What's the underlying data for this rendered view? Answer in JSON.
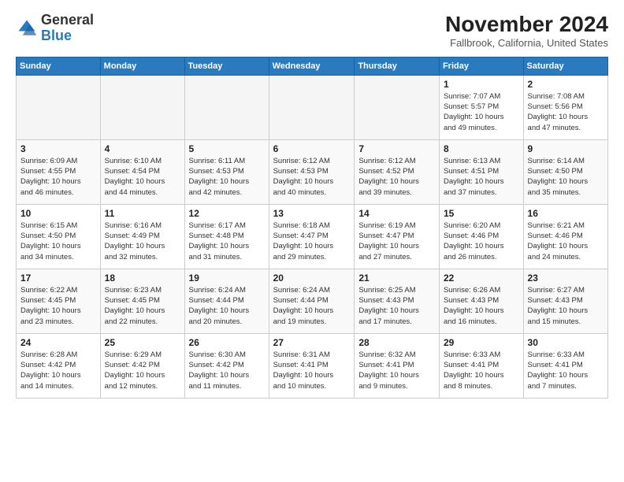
{
  "header": {
    "logo_general": "General",
    "logo_blue": "Blue",
    "month_title": "November 2024",
    "location": "Fallbrook, California, United States"
  },
  "weekdays": [
    "Sunday",
    "Monday",
    "Tuesday",
    "Wednesday",
    "Thursday",
    "Friday",
    "Saturday"
  ],
  "weeks": [
    [
      {
        "day": "",
        "info": ""
      },
      {
        "day": "",
        "info": ""
      },
      {
        "day": "",
        "info": ""
      },
      {
        "day": "",
        "info": ""
      },
      {
        "day": "",
        "info": ""
      },
      {
        "day": "1",
        "info": "Sunrise: 7:07 AM\nSunset: 5:57 PM\nDaylight: 10 hours\nand 49 minutes."
      },
      {
        "day": "2",
        "info": "Sunrise: 7:08 AM\nSunset: 5:56 PM\nDaylight: 10 hours\nand 47 minutes."
      }
    ],
    [
      {
        "day": "3",
        "info": "Sunrise: 6:09 AM\nSunset: 4:55 PM\nDaylight: 10 hours\nand 46 minutes."
      },
      {
        "day": "4",
        "info": "Sunrise: 6:10 AM\nSunset: 4:54 PM\nDaylight: 10 hours\nand 44 minutes."
      },
      {
        "day": "5",
        "info": "Sunrise: 6:11 AM\nSunset: 4:53 PM\nDaylight: 10 hours\nand 42 minutes."
      },
      {
        "day": "6",
        "info": "Sunrise: 6:12 AM\nSunset: 4:53 PM\nDaylight: 10 hours\nand 40 minutes."
      },
      {
        "day": "7",
        "info": "Sunrise: 6:12 AM\nSunset: 4:52 PM\nDaylight: 10 hours\nand 39 minutes."
      },
      {
        "day": "8",
        "info": "Sunrise: 6:13 AM\nSunset: 4:51 PM\nDaylight: 10 hours\nand 37 minutes."
      },
      {
        "day": "9",
        "info": "Sunrise: 6:14 AM\nSunset: 4:50 PM\nDaylight: 10 hours\nand 35 minutes."
      }
    ],
    [
      {
        "day": "10",
        "info": "Sunrise: 6:15 AM\nSunset: 4:50 PM\nDaylight: 10 hours\nand 34 minutes."
      },
      {
        "day": "11",
        "info": "Sunrise: 6:16 AM\nSunset: 4:49 PM\nDaylight: 10 hours\nand 32 minutes."
      },
      {
        "day": "12",
        "info": "Sunrise: 6:17 AM\nSunset: 4:48 PM\nDaylight: 10 hours\nand 31 minutes."
      },
      {
        "day": "13",
        "info": "Sunrise: 6:18 AM\nSunset: 4:47 PM\nDaylight: 10 hours\nand 29 minutes."
      },
      {
        "day": "14",
        "info": "Sunrise: 6:19 AM\nSunset: 4:47 PM\nDaylight: 10 hours\nand 27 minutes."
      },
      {
        "day": "15",
        "info": "Sunrise: 6:20 AM\nSunset: 4:46 PM\nDaylight: 10 hours\nand 26 minutes."
      },
      {
        "day": "16",
        "info": "Sunrise: 6:21 AM\nSunset: 4:46 PM\nDaylight: 10 hours\nand 24 minutes."
      }
    ],
    [
      {
        "day": "17",
        "info": "Sunrise: 6:22 AM\nSunset: 4:45 PM\nDaylight: 10 hours\nand 23 minutes."
      },
      {
        "day": "18",
        "info": "Sunrise: 6:23 AM\nSunset: 4:45 PM\nDaylight: 10 hours\nand 22 minutes."
      },
      {
        "day": "19",
        "info": "Sunrise: 6:24 AM\nSunset: 4:44 PM\nDaylight: 10 hours\nand 20 minutes."
      },
      {
        "day": "20",
        "info": "Sunrise: 6:24 AM\nSunset: 4:44 PM\nDaylight: 10 hours\nand 19 minutes."
      },
      {
        "day": "21",
        "info": "Sunrise: 6:25 AM\nSunset: 4:43 PM\nDaylight: 10 hours\nand 17 minutes."
      },
      {
        "day": "22",
        "info": "Sunrise: 6:26 AM\nSunset: 4:43 PM\nDaylight: 10 hours\nand 16 minutes."
      },
      {
        "day": "23",
        "info": "Sunrise: 6:27 AM\nSunset: 4:43 PM\nDaylight: 10 hours\nand 15 minutes."
      }
    ],
    [
      {
        "day": "24",
        "info": "Sunrise: 6:28 AM\nSunset: 4:42 PM\nDaylight: 10 hours\nand 14 minutes."
      },
      {
        "day": "25",
        "info": "Sunrise: 6:29 AM\nSunset: 4:42 PM\nDaylight: 10 hours\nand 12 minutes."
      },
      {
        "day": "26",
        "info": "Sunrise: 6:30 AM\nSunset: 4:42 PM\nDaylight: 10 hours\nand 11 minutes."
      },
      {
        "day": "27",
        "info": "Sunrise: 6:31 AM\nSunset: 4:41 PM\nDaylight: 10 hours\nand 10 minutes."
      },
      {
        "day": "28",
        "info": "Sunrise: 6:32 AM\nSunset: 4:41 PM\nDaylight: 10 hours\nand 9 minutes."
      },
      {
        "day": "29",
        "info": "Sunrise: 6:33 AM\nSunset: 4:41 PM\nDaylight: 10 hours\nand 8 minutes."
      },
      {
        "day": "30",
        "info": "Sunrise: 6:33 AM\nSunset: 4:41 PM\nDaylight: 10 hours\nand 7 minutes."
      }
    ]
  ]
}
